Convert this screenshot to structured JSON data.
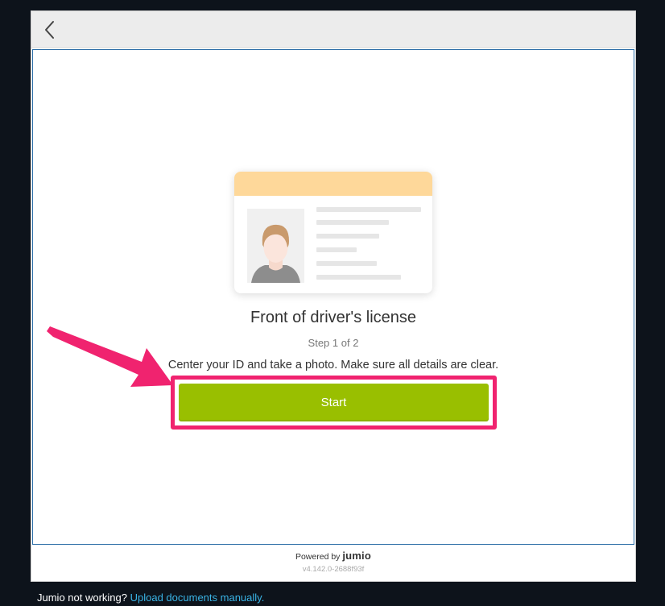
{
  "header": {
    "back_icon": "chevron-left-icon"
  },
  "main": {
    "card_icon": "drivers-license-illustration",
    "title": "Front of driver's license",
    "step": "Step 1 of 2",
    "instructions": "Center your ID and take a photo. Make sure all details are clear.",
    "start_label": "Start"
  },
  "footer_inner": {
    "powered_by": "Powered by",
    "brand": "jumio",
    "version": "v4.142.0-2688f93f"
  },
  "footer": {
    "prompt": "Jumio not working?",
    "link": "Upload documents manually."
  },
  "colors": {
    "accent": "#99bf00",
    "highlight": "#f0236f",
    "link": "#3ab4e6",
    "card_header": "#fed89a"
  }
}
